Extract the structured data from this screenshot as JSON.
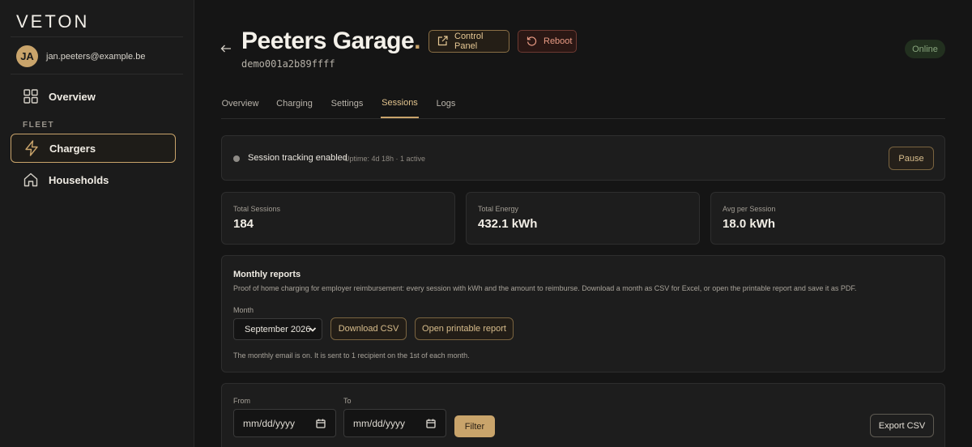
{
  "app": {
    "logo": "VETON"
  },
  "user": {
    "initials": "JA",
    "email": "jan.peeters@example.be"
  },
  "sidebar": {
    "items": [
      {
        "label": "Overview",
        "icon": "grid-icon"
      },
      {
        "label": "Chargers",
        "icon": "lightning-icon",
        "active": true
      },
      {
        "label": "Households",
        "icon": "home-icon"
      }
    ],
    "section_label": "FLEET"
  },
  "header": {
    "title": "Peeters Garage",
    "title_dot": ".",
    "device_id": "demo001a2b89ffff",
    "control_panel_label": "Control Panel",
    "reboot_label": "Reboot",
    "status": "Online"
  },
  "tabs": [
    {
      "label": "Overview"
    },
    {
      "label": "Charging"
    },
    {
      "label": "Settings"
    },
    {
      "label": "Sessions",
      "active": true
    },
    {
      "label": "Logs"
    }
  ],
  "tracking": {
    "label": "Session tracking enabled",
    "sub": "Uptime: 4d 18h · 1 active",
    "pause_label": "Pause"
  },
  "stats": [
    {
      "label": "Total Sessions",
      "value": "184"
    },
    {
      "label": "Total Energy",
      "value": "432.1 kWh"
    },
    {
      "label": "Avg per Session",
      "value": "18.0 kWh"
    }
  ],
  "reports": {
    "title": "Monthly reports",
    "description": "Proof of home charging for employer reimbursement: every session with kWh and the amount to reimburse. Download a month as CSV for Excel, or open the printable report and save it as PDF.",
    "month_label": "Month",
    "month_value": "September 2026",
    "download_csv_label": "Download CSV",
    "printable_label": "Open printable report",
    "note": "The monthly email is on. It is sent to 1 recipient on the 1st of each month."
  },
  "filter": {
    "from_label": "From",
    "from_placeholder": "mm/dd/yyyy",
    "to_label": "To",
    "to_placeholder": "mm/dd/yyyy",
    "filter_label": "Filter",
    "export_label": "Export CSV"
  },
  "colors": {
    "accent": "#c9a46b",
    "background": "#151515",
    "online": "#88a57d",
    "reboot": "#e89a84"
  }
}
